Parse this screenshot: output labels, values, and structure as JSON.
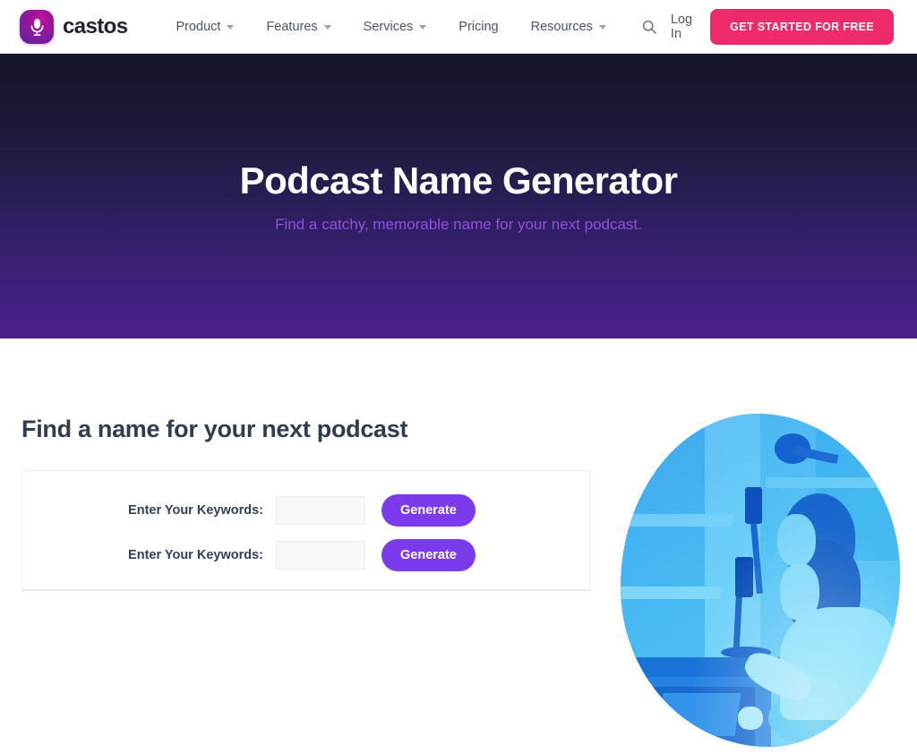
{
  "nav": {
    "brand": "castos",
    "brand_icon": "microphone-icon",
    "links": [
      {
        "label": "Product",
        "has_dropdown": true
      },
      {
        "label": "Features",
        "has_dropdown": true
      },
      {
        "label": "Services",
        "has_dropdown": true
      },
      {
        "label": "Pricing",
        "has_dropdown": false
      },
      {
        "label": "Resources",
        "has_dropdown": true
      }
    ],
    "search_icon": "search-icon",
    "login_label": "Log In",
    "cta_label": "GET STARTED FOR FREE",
    "cta_color": "#ee2a6b"
  },
  "hero": {
    "title": "Podcast Name Generator",
    "subtitle": "Find a catchy, memorable name for your next podcast.",
    "gradient_from": "#131528",
    "gradient_to": "#4b1f8c",
    "subtitle_color": "#8d4fdd"
  },
  "main": {
    "section_title": "Find a name for your next podcast",
    "form": {
      "rows": [
        {
          "label": "Enter Your Keywords:",
          "value": "",
          "placeholder": "",
          "button_label": "Generate"
        },
        {
          "label": "Enter Your Keywords:",
          "value": "",
          "placeholder": "",
          "button_label": "Generate"
        }
      ],
      "button_color": "#7c3aed"
    },
    "photo": {
      "alt": "Woman recording a podcast with studio microphones",
      "shape": "blob-oval",
      "duotone_color": "#2ea8ef"
    }
  }
}
